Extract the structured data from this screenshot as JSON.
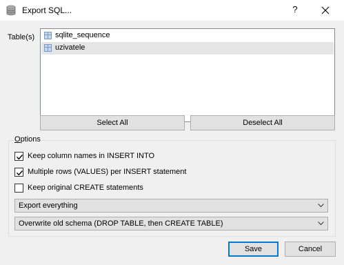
{
  "window": {
    "title": "Export SQL...",
    "help_label": "?"
  },
  "tables": {
    "label": "Table(s)",
    "items": [
      {
        "label": "sqlite_sequence",
        "selected": false
      },
      {
        "label": "uzivatele",
        "selected": true
      }
    ]
  },
  "buttons": {
    "select_all": "Select All",
    "deselect_all": "Deselect All",
    "save": "Save",
    "cancel": "Cancel"
  },
  "options": {
    "legend_underlined": "O",
    "legend_rest": "ptions",
    "keep_column_names": {
      "label": "Keep column names in INSERT INTO",
      "checked": true
    },
    "multiple_rows": {
      "label": "Multiple rows (VALUES) per INSERT statement",
      "checked": true
    },
    "keep_create": {
      "label": "Keep original CREATE statements",
      "checked": false
    },
    "export_mode": "Export everything",
    "schema_mode": "Overwrite old schema (DROP TABLE, then CREATE TABLE)"
  },
  "colors": {
    "selected_row": "#e5e5e5",
    "button_face": "#e1e1e1",
    "default_border": "#0078d7"
  }
}
